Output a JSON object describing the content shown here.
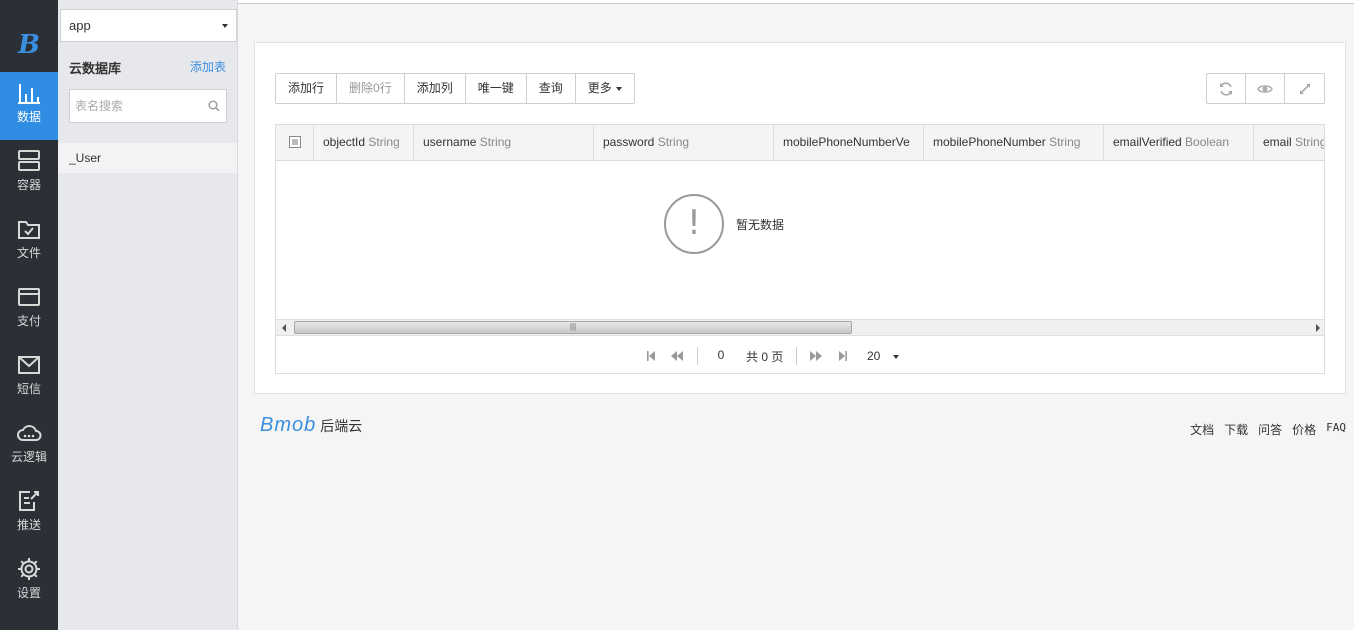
{
  "rail": {
    "logo": "B",
    "items": [
      {
        "label": "数据",
        "icon": "bar-chart-icon",
        "active": true
      },
      {
        "label": "容器",
        "icon": "server-icon",
        "active": false
      },
      {
        "label": "文件",
        "icon": "folder-check-icon",
        "active": false
      },
      {
        "label": "支付",
        "icon": "card-icon",
        "active": false
      },
      {
        "label": "短信",
        "icon": "mail-icon",
        "active": false
      },
      {
        "label": "云逻辑",
        "icon": "cloud-icon",
        "active": false
      },
      {
        "label": "推送",
        "icon": "push-icon",
        "active": false
      },
      {
        "label": "设置",
        "icon": "gear-icon",
        "active": false
      }
    ]
  },
  "sidebar": {
    "app_select": "app",
    "title": "云数据库",
    "add_table": "添加表",
    "search_placeholder": "表名搜索",
    "tables": [
      "_User"
    ]
  },
  "toolbar": {
    "add_row": "添加行",
    "delete_rows": "删除0行",
    "add_column": "添加列",
    "unique_key": "唯一键",
    "query": "查询",
    "more": "更多"
  },
  "tools": [
    "refresh-icon",
    "eye-icon",
    "fullscreen-icon"
  ],
  "table": {
    "columns": [
      {
        "name": "objectId",
        "type": "String"
      },
      {
        "name": "username",
        "type": "String"
      },
      {
        "name": "password",
        "type": "String"
      },
      {
        "name": "mobilePhoneNumberVe",
        "type": ""
      },
      {
        "name": "mobilePhoneNumber",
        "type": "String"
      },
      {
        "name": "emailVerified",
        "type": "Boolean"
      },
      {
        "name": "email",
        "type": "String"
      }
    ],
    "empty_text": "暂无数据"
  },
  "pager": {
    "page": "0",
    "total": "共 0 页",
    "page_size": "20"
  },
  "footer": {
    "brand": "Bmob",
    "brand_sub": "后端云",
    "links": [
      "文档",
      "下载",
      "问答",
      "价格",
      "FAQ"
    ]
  },
  "colors": {
    "accent": "#2f8de4",
    "rail_bg": "#2b2f36",
    "sidebar_bg": "#e7e8ec"
  }
}
